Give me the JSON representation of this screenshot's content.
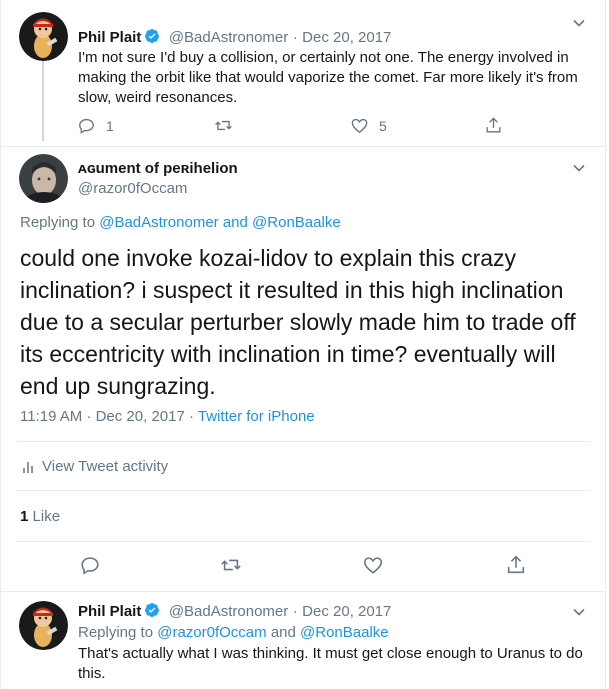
{
  "tweet1": {
    "name": "Phil Plait",
    "handle": "@BadAstronomer",
    "separator": "·",
    "date": "Dec 20, 2017",
    "text": "I'm not sure I'd buy a collision, or certainly not one. The energy involved in making the orbit like that would vaporize the comet. Far more likely it's from slow, weird resonances.",
    "reply_count": "1",
    "like_count": "5"
  },
  "tweet2": {
    "name": "ᴀɢument of peʀihelion",
    "handle": "@razor0fOccam",
    "replying_prefix": "Replying to",
    "mention1": "@BadAstronomer",
    "and_word": "and",
    "mention2": "@RonBaalke",
    "text": "could one invoke kozai-lidov to explain this crazy inclination? i suspect it resulted in this high inclination due to a secular perturber slowly made him to trade off its eccentricity with inclination in time? eventually will end up sungrazing.",
    "time": "11:19 AM · Dec 20, 2017",
    "dot": "·",
    "source": "Twitter for iPhone",
    "activity_label": "View Tweet activity",
    "likes_number": "1",
    "likes_label": "Like"
  },
  "tweet3": {
    "name": "Phil Plait",
    "handle": "@BadAstronomer",
    "separator": "·",
    "date": "Dec 20, 2017",
    "replying_prefix": "Replying to",
    "mention1": "@razor0fOccam",
    "and_word": "and",
    "mention2": "@RonBaalke",
    "text": "That's actually what I was thinking. It must get close enough to Uranus to do this."
  },
  "colors": {
    "link": "#1b95e0",
    "muted": "#657786",
    "text": "#14171a",
    "divider": "#e6ecf0"
  }
}
